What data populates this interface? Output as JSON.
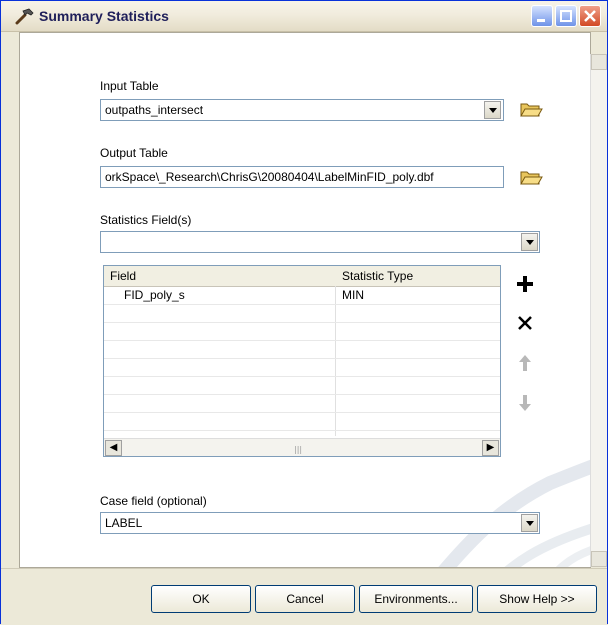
{
  "window": {
    "title": "Summary Statistics"
  },
  "input_table": {
    "label": "Input Table",
    "value": "outpaths_intersect"
  },
  "output_table": {
    "label": "Output Table",
    "value": "orkSpace\\_Research\\ChrisG\\20080404\\LabelMinFID_poly.dbf"
  },
  "statistics_fields": {
    "label": "Statistics Field(s)",
    "value": ""
  },
  "grid": {
    "columns": [
      "Field",
      "Statistic Type"
    ],
    "rows": [
      {
        "field": "FID_poly_s",
        "statistic": "MIN"
      }
    ]
  },
  "case_field": {
    "label": "Case field (optional)",
    "value": "LABEL"
  },
  "buttons": {
    "ok": "OK",
    "cancel": "Cancel",
    "environments": "Environments...",
    "help": "Show Help >>"
  },
  "icons": [
    "hammer-icon",
    "folder-open-icon",
    "add-icon",
    "delete-icon",
    "move-up-icon",
    "move-down-icon"
  ]
}
